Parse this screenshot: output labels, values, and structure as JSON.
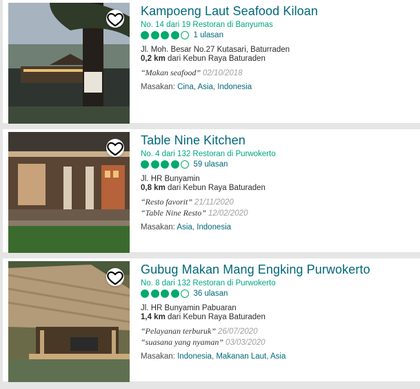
{
  "colors": {
    "brand_link": "#00677a",
    "rank_green": "#00a680",
    "bubble_green": "#00aa6c"
  },
  "restaurants": [
    {
      "name": "Kampoeng Laut Seafood Kiloan",
      "rank": "No. 14 dari 19 Restoran di Banyumas",
      "rating_bubbles": 4,
      "rating_max": 5,
      "reviews": "1 ulasan",
      "address": "Jl. Moh. Besar No.27 Kutasari, Baturraden",
      "distance": "0,2 km",
      "distance_text": "dari Kebun Raya Baturaden",
      "quotes": [
        {
          "text": "“Makan seafood”",
          "date": "02/10/2018"
        }
      ],
      "cuisine_label": "Masakan:",
      "cuisines": [
        "Cina",
        "Asia",
        "Indonesia"
      ],
      "photo": "restaurant-photo-outdoor-tree",
      "save_icon": "heart-icon"
    },
    {
      "name": "Table Nine Kitchen",
      "rank": "No. 4 dari 132 Restoran di Purwokerto",
      "rating_bubbles": 4,
      "rating_max": 5,
      "reviews": "59 ulasan",
      "address": "Jl. HR Bunyamin",
      "distance": "0,8 km",
      "distance_text": "dari Kebun Raya Baturaden",
      "quotes": [
        {
          "text": "“Resto favorit”",
          "date": "21/11/2020"
        },
        {
          "text": "“Table Nine Resto”",
          "date": "12/02/2020"
        }
      ],
      "cuisine_label": "Masakan:",
      "cuisines": [
        "Asia",
        "Indonesia"
      ],
      "photo": "restaurant-photo-night-terrace",
      "save_icon": "heart-icon"
    },
    {
      "name": "Gubug Makan Mang Engking Purwokerto",
      "rank": "No. 8 dari 132 Restoran di Purwokerto",
      "rating_bubbles": 4,
      "rating_max": 5,
      "reviews": "36 ulasan",
      "address": "Jl. HR Bunyamin Pabuaran",
      "distance": "1,4 km",
      "distance_text": "dari Kebun Raya Baturaden",
      "quotes": [
        {
          "text": "“Pelayanan terburuk”",
          "date": "26/07/2020"
        },
        {
          "text": "“suasana yang nyaman”",
          "date": "03/03/2020"
        }
      ],
      "cuisine_label": "Masakan:",
      "cuisines": [
        "Indonesia",
        "Makanan Laut",
        "Asia"
      ],
      "photo": "restaurant-photo-thatched-hut",
      "save_icon": "heart-icon"
    }
  ]
}
